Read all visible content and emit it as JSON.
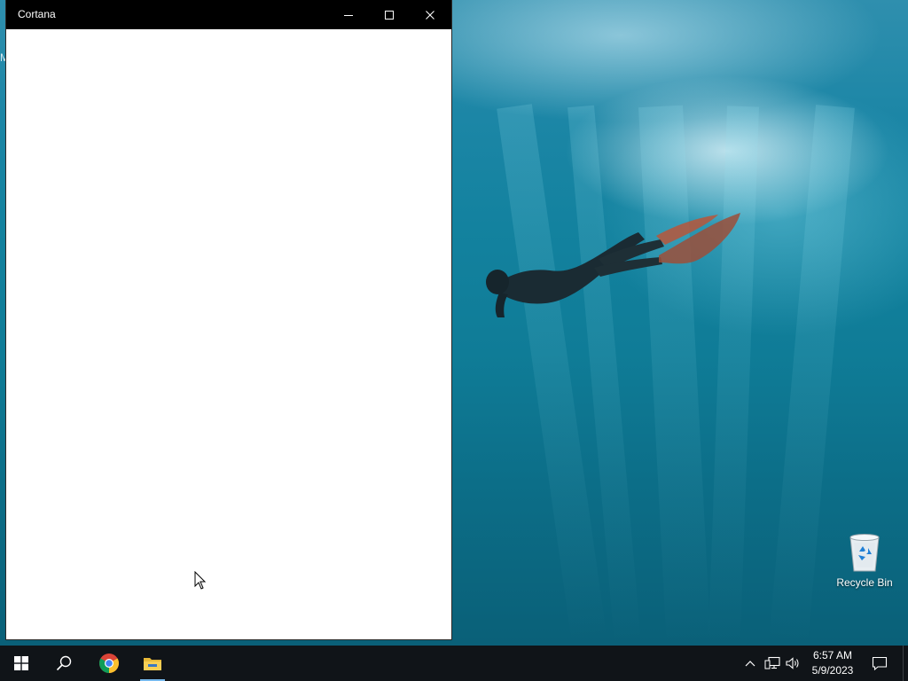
{
  "window": {
    "title": "Cortana",
    "controls": {
      "minimize_icon": "minimize-icon",
      "maximize_icon": "maximize-icon",
      "close_icon": "close-icon"
    }
  },
  "desktop": {
    "edge_text": "M",
    "icons": [
      {
        "label": "Recycle Bin",
        "icon": "recycle-bin-icon"
      }
    ]
  },
  "taskbar": {
    "pinned": [
      {
        "name": "start",
        "icon": "windows-logo-icon"
      },
      {
        "name": "search",
        "icon": "search-icon"
      },
      {
        "name": "chrome",
        "icon": "chrome-icon"
      },
      {
        "name": "file-explorer",
        "icon": "folder-icon",
        "active": true
      }
    ],
    "tray": {
      "chevron_icon": "chevron-up-icon",
      "network_icon": "network-icon",
      "volume_icon": "volume-icon",
      "notification_icon": "notification-icon"
    },
    "clock": {
      "time": "6:57 AM",
      "date": "5/9/2023"
    }
  },
  "colors": {
    "titlebar": "#000000",
    "taskbar": "#101418",
    "accent": "#76b9ed"
  }
}
